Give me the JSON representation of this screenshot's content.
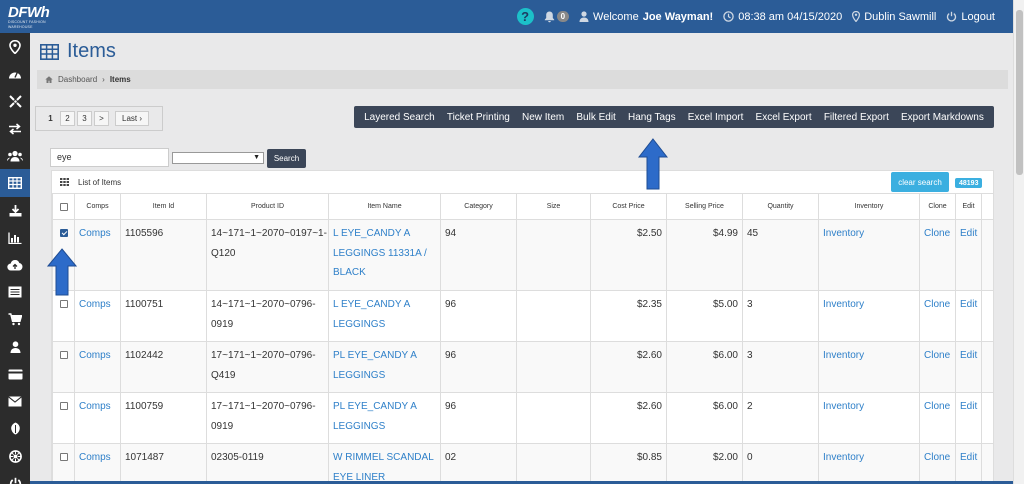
{
  "topbar": {
    "logo_text": "DFWh",
    "logo_subtext": "DISCOUNT FASHION WAREHOUSE",
    "help": "?",
    "notifications": "0",
    "welcome_prefix": "Welcome",
    "user_name": "Joe Wayman!",
    "datetime": "08:38 am 04/15/2020",
    "location": "Dublin Sawmill",
    "logout": "Logout"
  },
  "page": {
    "title": "Items"
  },
  "breadcrumb": {
    "home": "Dashboard",
    "current": "Items"
  },
  "pagination": {
    "pages": [
      "1",
      "2",
      "3",
      ">"
    ],
    "last": "Last ›"
  },
  "toolbar": {
    "buttons": [
      "Layered Search",
      "Ticket Printing",
      "New Item",
      "Bulk Edit",
      "Hang Tags",
      "Excel Import",
      "Excel Export",
      "Filtered Export",
      "Export Markdowns"
    ]
  },
  "search": {
    "value": "eye",
    "button": "Search"
  },
  "panel": {
    "title": "List of Items",
    "clear_search": "clear search",
    "count": "48193"
  },
  "table": {
    "headers": [
      "",
      "Comps",
      "Item Id",
      "Product ID",
      "Item Name",
      "Category",
      "Size",
      "Cost Price",
      "Selling Price",
      "Quantity",
      "Inventory",
      "Clone",
      "Edit"
    ],
    "rows": [
      {
        "checked": true,
        "comps": "Comps",
        "item_id": "1105596",
        "product_id": "14~171~1~2070~0197~1-Q120",
        "name": "L EYE_CANDY A LEGGINGS 11331A / BLACK",
        "category": "94",
        "size": "",
        "cost": "$2.50",
        "sell": "$4.99",
        "qty": "45",
        "inventory": "Inventory",
        "clone": "Clone",
        "edit": "Edit"
      },
      {
        "checked": false,
        "comps": "Comps",
        "item_id": "1100751",
        "product_id": "14~171~1~2070~0796-0919",
        "name": "L EYE_CANDY A LEGGINGS",
        "category": "96",
        "size": "",
        "cost": "$2.35",
        "sell": "$5.00",
        "qty": "3",
        "inventory": "Inventory",
        "clone": "Clone",
        "edit": "Edit"
      },
      {
        "checked": false,
        "comps": "Comps",
        "item_id": "1102442",
        "product_id": "17~171~1~2070~0796-Q419",
        "name": "PL EYE_CANDY A LEGGINGS",
        "category": "96",
        "size": "",
        "cost": "$2.60",
        "sell": "$6.00",
        "qty": "3",
        "inventory": "Inventory",
        "clone": "Clone",
        "edit": "Edit"
      },
      {
        "checked": false,
        "comps": "Comps",
        "item_id": "1100759",
        "product_id": "17~171~1~2070~0796-0919",
        "name": "PL EYE_CANDY A LEGGINGS",
        "category": "96",
        "size": "",
        "cost": "$2.60",
        "sell": "$6.00",
        "qty": "2",
        "inventory": "Inventory",
        "clone": "Clone",
        "edit": "Edit"
      },
      {
        "checked": false,
        "comps": "Comps",
        "item_id": "1071487",
        "product_id": "02305-0119",
        "name": "W RIMMEL SCANDAL EYE LINER",
        "category": "02",
        "size": "",
        "cost": "$0.85",
        "sell": "$2.00",
        "qty": "0",
        "inventory": "Inventory",
        "clone": "Clone",
        "edit": "Edit"
      }
    ]
  },
  "sidebar": {
    "icons": [
      "map-pin-icon",
      "dashboard-icon",
      "crosshair-icon",
      "transfer-icon",
      "users-icon",
      "items-icon",
      "download-icon",
      "bar-chart-icon",
      "cloud-upload-icon",
      "list-icon",
      "cart-icon",
      "user-icon",
      "credit-card-icon",
      "envelope-icon",
      "rebel-icon",
      "empire-icon",
      "power-icon"
    ],
    "active_index": 5
  },
  "colors": {
    "topbar": "#2b5c97",
    "toolbar": "#3b4658",
    "link": "#2f80c9",
    "accent": "#3bafe0",
    "sidebar": "#2c2c2c",
    "arrow": "#2d6bc9"
  }
}
